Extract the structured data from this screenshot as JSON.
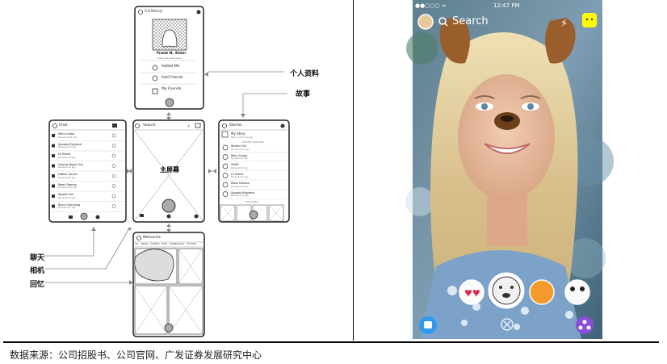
{
  "mockup": {
    "profile": {
      "header": "Full Bitmoji",
      "name": "Frank N. Stein",
      "sub": "snapchat username",
      "items": [
        "Added Me",
        "Add Friends",
        "My Friends"
      ]
    },
    "chat": {
      "title": "Chat",
      "rows": [
        {
          "name": "Mimi Creep",
          "sub": "Received just now"
        },
        {
          "name": "Spooky Bleyleck",
          "sub": "Received 1m ago"
        },
        {
          "name": "Lil Skeet",
          "sub": "Received 3h ago"
        },
        {
          "name": "Ghouls Night Out",
          "sub": "Received 5h ago"
        },
        {
          "name": "Hatter Haunt",
          "sub": "Received 8h ago"
        },
        {
          "name": "Meat Demon",
          "sub": "Received 10h ago"
        },
        {
          "name": "Wraith Hill",
          "sub": "Received 1d ago"
        },
        {
          "name": "Ryan Ghoulling",
          "sub": "Received 2d ago"
        }
      ]
    },
    "camera": {
      "search": "Search",
      "center_label": "主屏幕"
    },
    "stories": {
      "title": "Stories",
      "my_story": "My Story",
      "my_story_sub": "Tap to add a Snap",
      "recent_header": "RECENT UPDATES",
      "rows": [
        {
          "name": "Wraith Hill",
          "sub": "Received 1m ago"
        },
        {
          "name": "Mimi Creep",
          "sub": "Received 3h ago"
        },
        {
          "name": "XOXO",
          "sub": "Received 5h ago"
        },
        {
          "name": "Lil Skeet",
          "sub": "Received 7h ago"
        },
        {
          "name": "Meat Demon",
          "sub": "Received 9h ago"
        },
        {
          "name": "Spooky Bleyleck",
          "sub": "Received 1d ago"
        }
      ],
      "discover_header": "DISCOVER"
    },
    "memories": {
      "title": "Memories",
      "tabs": [
        "ALL",
        "SNAPS",
        "STORIES",
        "EYES",
        "CAMERA ROLL",
        "MY EYES"
      ]
    }
  },
  "labels": {
    "profile": "个人资料",
    "stories": "故事",
    "chat": "聊天",
    "camera": "相机",
    "memories": "回忆"
  },
  "phone": {
    "carrier": "●●○○○ ≈",
    "time": "12:47 PM",
    "search": "Search"
  },
  "footer": {
    "source": "数据来源：公司招股书、公司官网、广发证券发展研究中心"
  },
  "colors": {
    "accent_yellow": "#fffc00",
    "memories_blue": "#2e9bf0",
    "discover_purple": "#8a4fd6"
  }
}
